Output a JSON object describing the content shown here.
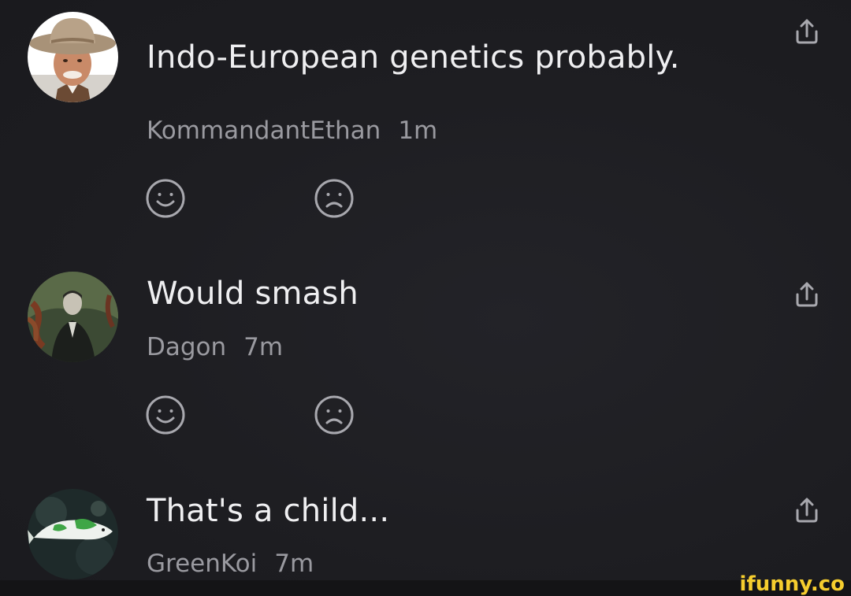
{
  "comments": [
    {
      "text": "Indo-European genetics probably.",
      "username": "KommandantEthan",
      "time": "1m",
      "avatar_icon": "cowboy-avatar"
    },
    {
      "text": "Would smash",
      "username": "Dagon",
      "time": "7m",
      "avatar_icon": "lovecraft-avatar"
    },
    {
      "text": "That's a child...",
      "username": "GreenKoi",
      "time": "7m",
      "avatar_icon": "koi-fish-avatar"
    }
  ],
  "icons": {
    "share": "share-icon",
    "like": "smile-icon",
    "dislike": "frown-icon"
  },
  "watermark": "ifunny.co",
  "colors": {
    "background": "#1e1e22",
    "text": "#efeff1",
    "meta": "#9a9aa0",
    "icon": "#a8a8ae",
    "watermark": "#f5cd2e"
  }
}
